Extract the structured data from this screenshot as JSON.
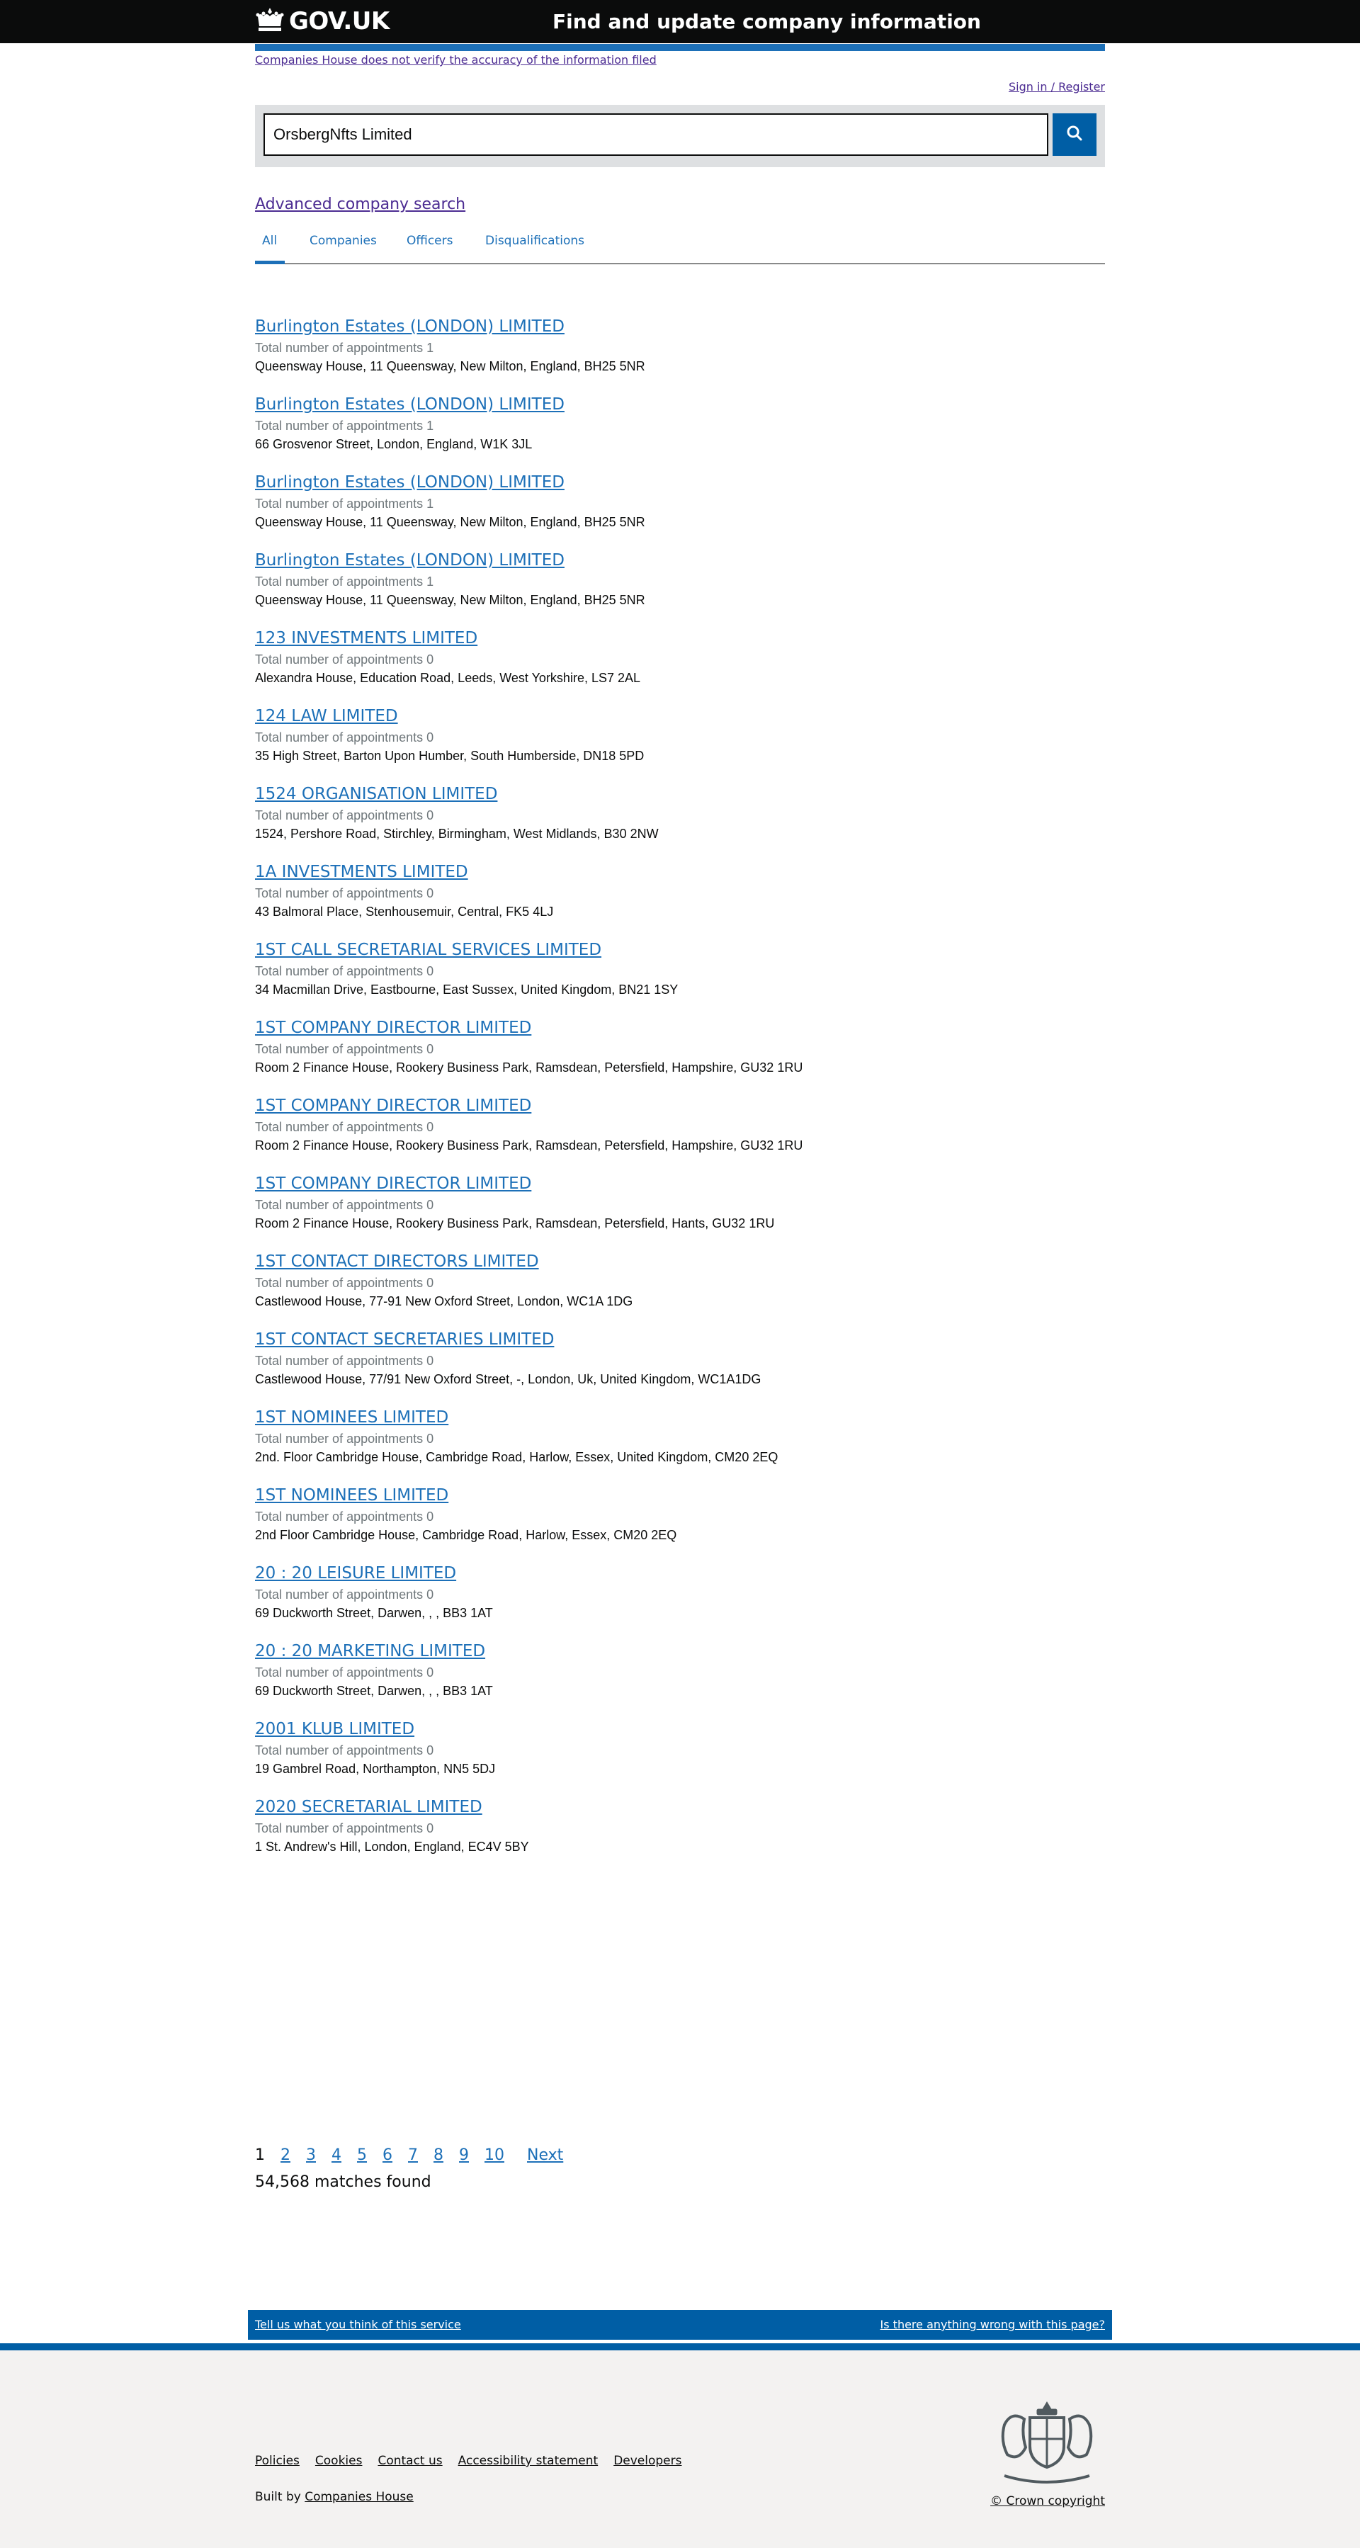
{
  "header": {
    "logo_text": "GOV.UK",
    "logo_icon": "crown-icon",
    "service_name": "Find and update company information"
  },
  "banner": {
    "disclaimer": "Companies House does not verify the accuracy of the information filed",
    "signin": "Sign in / Register"
  },
  "search": {
    "value": "OrsbergNfts Limited",
    "button_icon": "search-icon"
  },
  "advanced_search": "Advanced company search",
  "tabs": [
    {
      "label": "All",
      "active": true
    },
    {
      "label": "Companies",
      "active": false
    },
    {
      "label": "Officers",
      "active": false
    },
    {
      "label": "Disqualifications",
      "active": false
    }
  ],
  "results": [
    {
      "title": "Burlington Estates (LONDON) LIMITED",
      "meta": "Total number of appointments 1",
      "address": "Queensway House, 11 Queensway, New Milton, England, BH25 5NR"
    },
    {
      "title": "Burlington Estates (LONDON) LIMITED",
      "meta": "Total number of appointments 1",
      "address": "66 Grosvenor Street, London, England, W1K 3JL"
    },
    {
      "title": "Burlington Estates (LONDON) LIMITED",
      "meta": "Total number of appointments 1",
      "address": "Queensway House, 11 Queensway, New Milton, England, BH25 5NR"
    },
    {
      "title": "Burlington Estates (LONDON) LIMITED",
      "meta": "Total number of appointments 1",
      "address": "Queensway House, 11 Queensway, New Milton, England, BH25 5NR"
    },
    {
      "title": "123 INVESTMENTS LIMITED",
      "meta": "Total number of appointments 0",
      "address": "Alexandra House, Education Road, Leeds, West Yorkshire, LS7 2AL"
    },
    {
      "title": "124 LAW LIMITED",
      "meta": "Total number of appointments 0",
      "address": "35 High Street, Barton Upon Humber, South Humberside, DN18 5PD"
    },
    {
      "title": "1524 ORGANISATION LIMITED",
      "meta": "Total number of appointments 0",
      "address": "1524, Pershore Road, Stirchley, Birmingham, West Midlands, B30 2NW"
    },
    {
      "title": "1A INVESTMENTS LIMITED",
      "meta": "Total number of appointments 0",
      "address": "43 Balmoral Place, Stenhousemuir, Central, FK5 4LJ"
    },
    {
      "title": "1ST CALL SECRETARIAL SERVICES LIMITED",
      "meta": "Total number of appointments 0",
      "address": "34 Macmillan Drive, Eastbourne, East Sussex, United Kingdom, BN21 1SY"
    },
    {
      "title": "1ST COMPANY DIRECTOR LIMITED",
      "meta": "Total number of appointments 0",
      "address": "Room 2 Finance House, Rookery Business Park, Ramsdean, Petersfield, Hampshire, GU32 1RU"
    },
    {
      "title": "1ST COMPANY DIRECTOR LIMITED",
      "meta": "Total number of appointments 0",
      "address": "Room 2 Finance House, Rookery Business Park, Ramsdean, Petersfield, Hampshire, GU32 1RU"
    },
    {
      "title": "1ST COMPANY DIRECTOR LIMITED",
      "meta": "Total number of appointments 0",
      "address": "Room 2 Finance House, Rookery Business Park, Ramsdean, Petersfield, Hants, GU32 1RU"
    },
    {
      "title": "1ST CONTACT DIRECTORS LIMITED",
      "meta": "Total number of appointments 0",
      "address": "Castlewood House, 77-91 New Oxford Street, London, WC1A 1DG"
    },
    {
      "title": "1ST CONTACT SECRETARIES LIMITED",
      "meta": "Total number of appointments 0",
      "address": "Castlewood House, 77/91 New Oxford Street, -, London, Uk, United Kingdom, WC1A1DG"
    },
    {
      "title": "1ST NOMINEES LIMITED",
      "meta": "Total number of appointments 0",
      "address": "2nd. Floor Cambridge House, Cambridge Road, Harlow, Essex, United Kingdom, CM20 2EQ"
    },
    {
      "title": "1ST NOMINEES LIMITED",
      "meta": "Total number of appointments 0",
      "address": "2nd Floor Cambridge House, Cambridge Road, Harlow, Essex, CM20 2EQ"
    },
    {
      "title": "20 : 20 LEISURE LIMITED",
      "meta": "Total number of appointments 0",
      "address": "69 Duckworth Street, Darwen, , , BB3 1AT"
    },
    {
      "title": "20 : 20 MARKETING LIMITED",
      "meta": "Total number of appointments 0",
      "address": "69 Duckworth Street, Darwen, , , BB3 1AT"
    },
    {
      "title": "2001 KLUB LIMITED",
      "meta": "Total number of appointments 0",
      "address": "19 Gambrel Road, Northampton, NN5 5DJ"
    },
    {
      "title": "2020 SECRETARIAL LIMITED",
      "meta": "Total number of appointments 0",
      "address": "1 St. Andrew's Hill, London, England, EC4V 5BY"
    }
  ],
  "pagination": {
    "current": "1",
    "pages": [
      "2",
      "3",
      "4",
      "5",
      "6",
      "7",
      "8",
      "9",
      "10"
    ],
    "next": "Next"
  },
  "matches": "54,568 matches found",
  "feedback": {
    "left": "Tell us what you think of this service",
    "right": "Is there anything wrong with this page?"
  },
  "footer": {
    "links": [
      "Policies",
      "Cookies",
      "Contact us",
      "Accessibility statement",
      "Developers"
    ],
    "built_by_prefix": "Built by",
    "built_by_link": "Companies House",
    "crest_icon": "royal-coat-of-arms-icon",
    "copyright": "© Crown copyright"
  },
  "colors": {
    "header_bg": "#0b0c0c",
    "link": "#1d70b8",
    "visited_link": "#4c2c92",
    "search_button": "#005ea5",
    "footer_bg": "#f3f2f1"
  }
}
